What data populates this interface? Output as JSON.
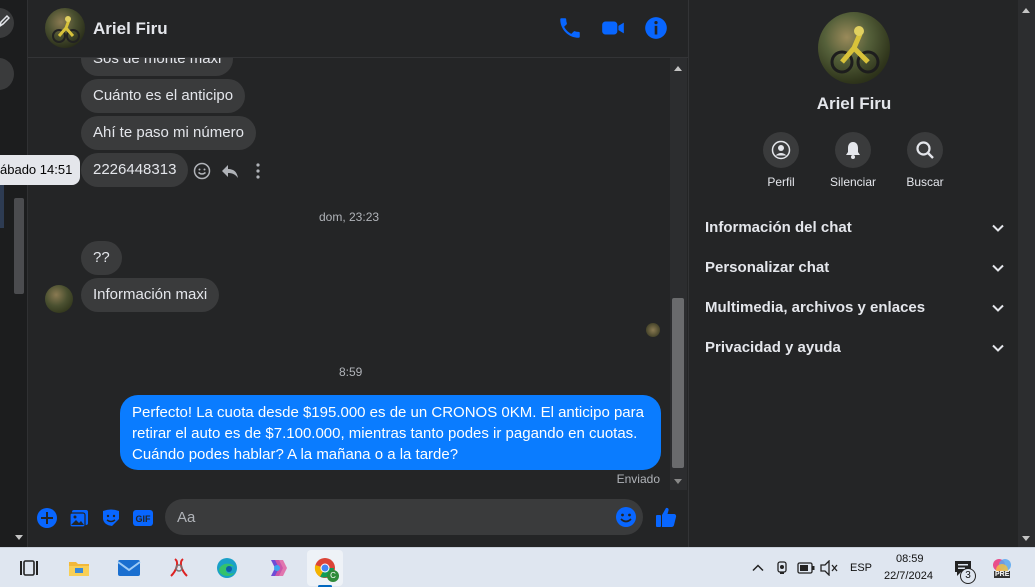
{
  "tooltip": "ábado 14:51",
  "contact": {
    "name": "Ariel Firu"
  },
  "messages": {
    "partial_top": "Sos de monte maxi",
    "m1": "Cuánto es el anticipo",
    "m2": "Ahí te paso mi número",
    "m3": "2226448313",
    "separator1": "dom, 23:23",
    "m4": "??",
    "m5": "Información maxi",
    "separator2": "8:59",
    "outgoing": "Perfecto! La cuota desde $195.000 es de un CRONOS 0KM. El anticipo para retirar el auto es de $7.100.000, mientras tanto podes ir pagando en cuotas. Cuándo podes hablar? A la mañana o a la tarde?",
    "status": "Enviado"
  },
  "composer": {
    "placeholder": "Aa"
  },
  "right_panel": {
    "name": "Ariel Firu",
    "actions": [
      "Perfil",
      "Silenciar",
      "Buscar"
    ],
    "sections": [
      "Información del chat",
      "Personalizar chat",
      "Multimedia, archivos y enlaces",
      "Privacidad y ayuda"
    ]
  },
  "taskbar": {
    "lang": "ESP",
    "time": "08:59",
    "date": "22/7/2024",
    "notification_count": "3",
    "pre_badge": "PRE",
    "chrome_badge": "C"
  },
  "colors": {
    "accent": "#0a7cff",
    "background": "#242526",
    "bubble_in": "#3a3b3c",
    "icon_blue": "#0866ff"
  }
}
